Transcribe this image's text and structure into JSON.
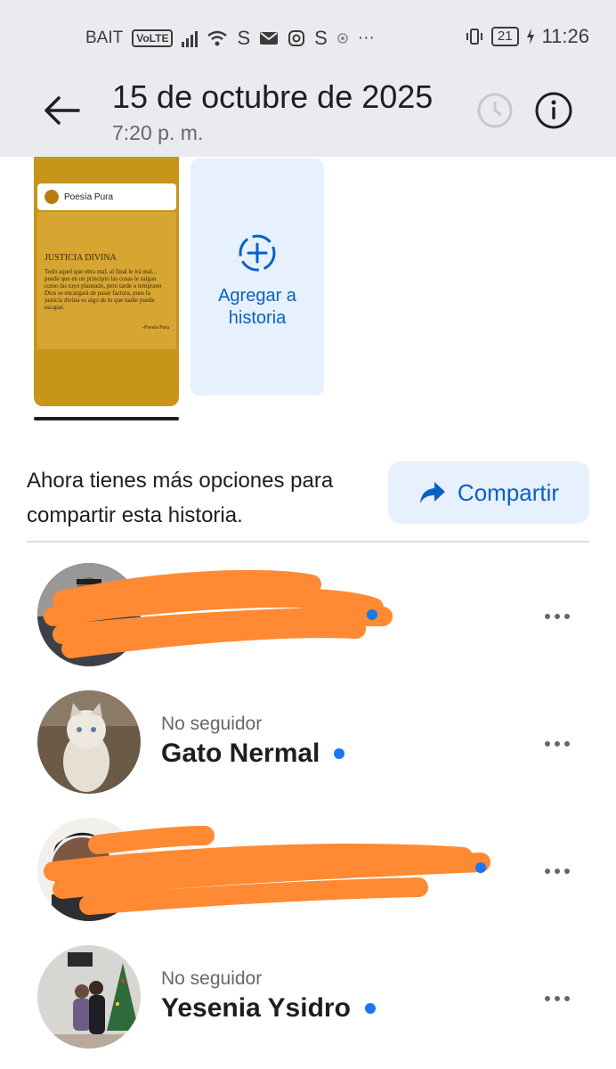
{
  "status_bar": {
    "carrier": "BAIT",
    "volte": "VoLTE",
    "signal_icon": "signal-bars-icon",
    "wifi_icon": "wifi-icon",
    "app_icons": [
      "S",
      "mail-icon",
      "instagram-icon",
      "S",
      "target-icon",
      "···"
    ],
    "battery": "21",
    "time": "11:26"
  },
  "header": {
    "title": "15 de octubre de 2025",
    "subtitle": "7:20 p. m.",
    "back_icon": "arrow-left-icon",
    "info_icon": "info-circle-icon"
  },
  "story": {
    "page_name": "Poesía Pura",
    "title": "JUSTICIA DIVINA",
    "text": "Todo aquel que obra mal, al final le irá mal... puede que en un principio las cosas le salgan como las tuyo planeado, pero tarde o temprano Dios se encargará de pasar factura, pues la justicia divina es algo de lo que nadie puede escapar.",
    "signature": "-Poesía Pura",
    "background": "#c6951a"
  },
  "add_story": {
    "label": "Agregar a historia",
    "icon": "add-circle-dashed-icon"
  },
  "share": {
    "text": "Ahora tienes más opciones para compartir esta historia.",
    "button_label": "Compartir",
    "icon": "share-arrow-icon"
  },
  "viewers": [
    {
      "subtitle": "",
      "name": "",
      "redacted": true,
      "verified_dot": true
    },
    {
      "subtitle": "No seguidor",
      "name": "Gato Nermal",
      "redacted": false,
      "verified_dot": true
    },
    {
      "subtitle": "",
      "name": "",
      "redacted": true,
      "verified_dot": true
    },
    {
      "subtitle": "No seguidor",
      "name": "Yesenia Ysidro",
      "redacted": false,
      "verified_dot": true
    }
  ],
  "colors": {
    "accent": "#0861c5",
    "accent_bg": "#e7f0fd",
    "dot": "#1877f2",
    "redaction": "#ff8a33",
    "header_bg": "#e9ebee"
  }
}
